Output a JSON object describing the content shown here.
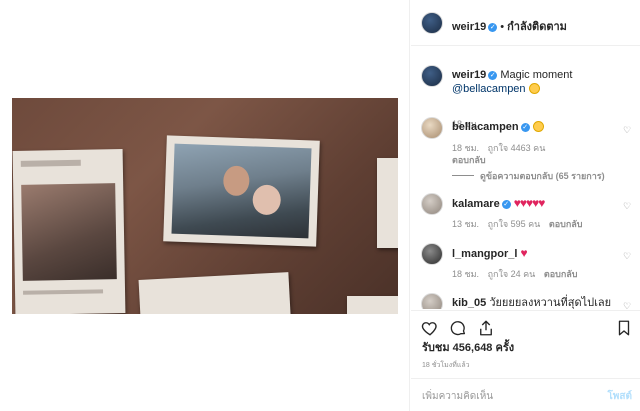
{
  "header": {
    "username": "weir19",
    "follow_status": "กำลังติดตาม"
  },
  "caption": {
    "username": "weir19",
    "text": "Magic moment",
    "mention": "@bellacampen",
    "time": "18 ชม."
  },
  "comments": [
    {
      "username": "bellacampen",
      "text_emoji": "smiling-face",
      "time": "18 ชม.",
      "likes": "ถูกใจ 4463 คน",
      "reply": "ตอบกลับ",
      "view_replies": "ดูข้อความตอบกลับ (65 รายการ)"
    },
    {
      "username": "kalamare",
      "text": "♥♥♥♥♥",
      "time": "13 ชม.",
      "likes": "ถูกใจ 595 คน",
      "reply": "ตอบกลับ"
    },
    {
      "username": "l_mangpor_l",
      "text": "♥",
      "time": "18 ชม.",
      "likes": "ถูกใจ 24 คน",
      "reply": "ตอบกลับ"
    },
    {
      "username": "kib_05",
      "text": "วัยยยยลงหวานที่สุดไปเลย"
    }
  ],
  "likes_total": "รับชม 456,648 ครั้ง",
  "time_ago": "18 ชั่วโมงที่แล้ว",
  "composer": {
    "placeholder": "เพิ่มความคิดเห็น",
    "post_label": "โพสต์"
  },
  "icons": {
    "like": "heart-icon",
    "comment": "comment-icon",
    "share": "share-icon",
    "save": "bookmark-icon",
    "verified": "verified-badge-icon"
  },
  "colors": {
    "verified": "#3897f0",
    "heart": "#e0245e",
    "post_disabled": "#b2dffc"
  }
}
